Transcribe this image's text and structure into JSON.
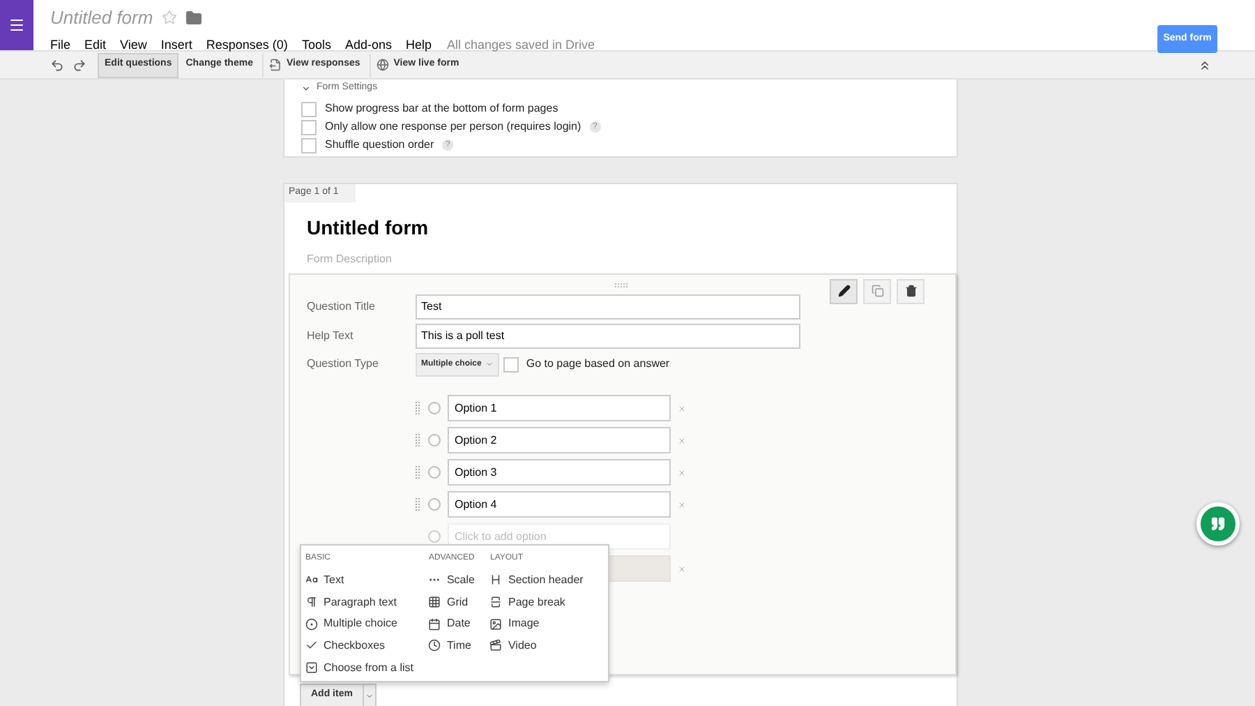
{
  "app": {
    "title": "Untitled form",
    "starred": false
  },
  "menu": [
    "File",
    "Edit",
    "View",
    "Insert",
    "Responses (0)",
    "Tools",
    "Add-ons",
    "Help"
  ],
  "save_status": "All changes saved in Drive",
  "send_button": "Send form",
  "toolbar": [
    {
      "label": "Edit questions",
      "kind": "tab",
      "selected": true
    },
    {
      "label": "Change theme",
      "kind": "tab",
      "selected": false
    },
    {
      "label": "View responses",
      "kind": "responses",
      "selected": false
    },
    {
      "label": "View live form",
      "kind": "live",
      "selected": false
    }
  ],
  "form_settings": {
    "title": "Form Settings",
    "expanded": true,
    "options": [
      {
        "label": "Show progress bar at the bottom of form pages",
        "checked": false
      },
      {
        "label": "Only allow one response per person (requires login)",
        "checked": false,
        "help": "?"
      },
      {
        "label": "Shuffle question order",
        "checked": false,
        "help": "?"
      }
    ]
  },
  "page": {
    "label": "Page 1 of 1",
    "title": "Untitled form",
    "description_placeholder": "Form Description"
  },
  "question": {
    "fields": [
      {
        "label": "Question Title",
        "value": "Test"
      },
      {
        "label": "Help Text",
        "value": "This is a poll test"
      }
    ],
    "type_label": "Question Type",
    "type_value": "Multiple choice",
    "go_to_page": {
      "label": "Go to page based on answer",
      "checked": false
    },
    "options": [
      {
        "label": "Option 1",
        "selected": false
      },
      {
        "label": "Option 2",
        "selected": false
      },
      {
        "label": "Option 3",
        "selected": false
      },
      {
        "label": "Option 4",
        "selected": false
      }
    ],
    "add_option": {
      "placeholder": "Click to add option",
      "selected": false
    }
  },
  "add_menu": {
    "columns": [
      {
        "heading": "BASIC",
        "items": [
          {
            "label": "Text",
            "kind": "text"
          },
          {
            "label": "Paragraph text",
            "kind": "paragraph"
          },
          {
            "label": "Multiple choice",
            "kind": "choice"
          },
          {
            "label": "Checkboxes",
            "kind": "check"
          },
          {
            "label": "Choose from a list",
            "kind": "list"
          }
        ]
      },
      {
        "heading": "ADVANCED",
        "items": [
          {
            "label": "Scale",
            "kind": "scale"
          },
          {
            "label": "Grid",
            "kind": "grid"
          },
          {
            "label": "Date",
            "kind": "date"
          },
          {
            "label": "Time",
            "kind": "time"
          }
        ]
      },
      {
        "heading": "LAYOUT",
        "items": [
          {
            "label": "Section header",
            "kind": "header"
          },
          {
            "label": "Page break",
            "kind": "pagebreak"
          },
          {
            "label": "Image",
            "kind": "image"
          },
          {
            "label": "Video",
            "kind": "video"
          }
        ]
      }
    ]
  },
  "add_item_button": "Add item"
}
